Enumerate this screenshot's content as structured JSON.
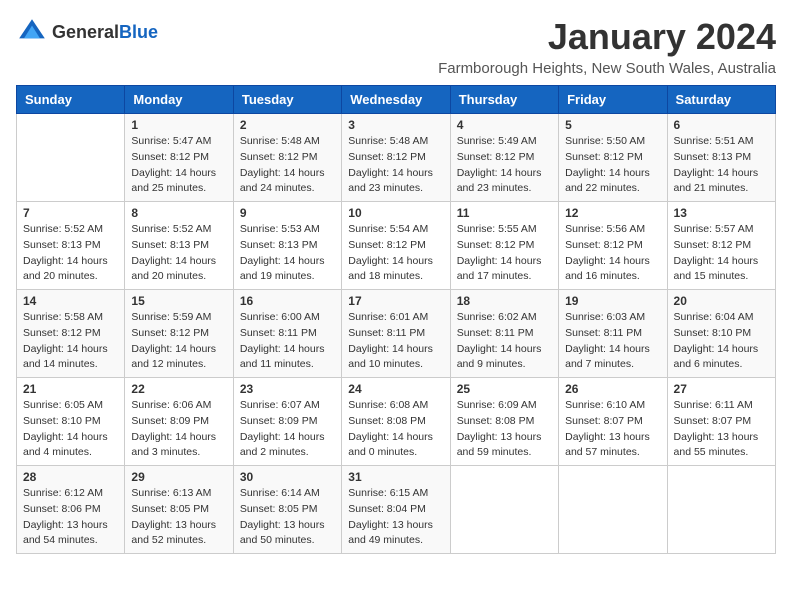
{
  "logo": {
    "general": "General",
    "blue": "Blue"
  },
  "title": "January 2024",
  "location": "Farmborough Heights, New South Wales, Australia",
  "days_of_week": [
    "Sunday",
    "Monday",
    "Tuesday",
    "Wednesday",
    "Thursday",
    "Friday",
    "Saturday"
  ],
  "weeks": [
    [
      {
        "day": "",
        "info": ""
      },
      {
        "day": "1",
        "info": "Sunrise: 5:47 AM\nSunset: 8:12 PM\nDaylight: 14 hours\nand 25 minutes."
      },
      {
        "day": "2",
        "info": "Sunrise: 5:48 AM\nSunset: 8:12 PM\nDaylight: 14 hours\nand 24 minutes."
      },
      {
        "day": "3",
        "info": "Sunrise: 5:48 AM\nSunset: 8:12 PM\nDaylight: 14 hours\nand 23 minutes."
      },
      {
        "day": "4",
        "info": "Sunrise: 5:49 AM\nSunset: 8:12 PM\nDaylight: 14 hours\nand 23 minutes."
      },
      {
        "day": "5",
        "info": "Sunrise: 5:50 AM\nSunset: 8:12 PM\nDaylight: 14 hours\nand 22 minutes."
      },
      {
        "day": "6",
        "info": "Sunrise: 5:51 AM\nSunset: 8:13 PM\nDaylight: 14 hours\nand 21 minutes."
      }
    ],
    [
      {
        "day": "7",
        "info": "Sunrise: 5:52 AM\nSunset: 8:13 PM\nDaylight: 14 hours\nand 20 minutes."
      },
      {
        "day": "8",
        "info": "Sunrise: 5:52 AM\nSunset: 8:13 PM\nDaylight: 14 hours\nand 20 minutes."
      },
      {
        "day": "9",
        "info": "Sunrise: 5:53 AM\nSunset: 8:13 PM\nDaylight: 14 hours\nand 19 minutes."
      },
      {
        "day": "10",
        "info": "Sunrise: 5:54 AM\nSunset: 8:12 PM\nDaylight: 14 hours\nand 18 minutes."
      },
      {
        "day": "11",
        "info": "Sunrise: 5:55 AM\nSunset: 8:12 PM\nDaylight: 14 hours\nand 17 minutes."
      },
      {
        "day": "12",
        "info": "Sunrise: 5:56 AM\nSunset: 8:12 PM\nDaylight: 14 hours\nand 16 minutes."
      },
      {
        "day": "13",
        "info": "Sunrise: 5:57 AM\nSunset: 8:12 PM\nDaylight: 14 hours\nand 15 minutes."
      }
    ],
    [
      {
        "day": "14",
        "info": "Sunrise: 5:58 AM\nSunset: 8:12 PM\nDaylight: 14 hours\nand 14 minutes."
      },
      {
        "day": "15",
        "info": "Sunrise: 5:59 AM\nSunset: 8:12 PM\nDaylight: 14 hours\nand 12 minutes."
      },
      {
        "day": "16",
        "info": "Sunrise: 6:00 AM\nSunset: 8:11 PM\nDaylight: 14 hours\nand 11 minutes."
      },
      {
        "day": "17",
        "info": "Sunrise: 6:01 AM\nSunset: 8:11 PM\nDaylight: 14 hours\nand 10 minutes."
      },
      {
        "day": "18",
        "info": "Sunrise: 6:02 AM\nSunset: 8:11 PM\nDaylight: 14 hours\nand 9 minutes."
      },
      {
        "day": "19",
        "info": "Sunrise: 6:03 AM\nSunset: 8:11 PM\nDaylight: 14 hours\nand 7 minutes."
      },
      {
        "day": "20",
        "info": "Sunrise: 6:04 AM\nSunset: 8:10 PM\nDaylight: 14 hours\nand 6 minutes."
      }
    ],
    [
      {
        "day": "21",
        "info": "Sunrise: 6:05 AM\nSunset: 8:10 PM\nDaylight: 14 hours\nand 4 minutes."
      },
      {
        "day": "22",
        "info": "Sunrise: 6:06 AM\nSunset: 8:09 PM\nDaylight: 14 hours\nand 3 minutes."
      },
      {
        "day": "23",
        "info": "Sunrise: 6:07 AM\nSunset: 8:09 PM\nDaylight: 14 hours\nand 2 minutes."
      },
      {
        "day": "24",
        "info": "Sunrise: 6:08 AM\nSunset: 8:08 PM\nDaylight: 14 hours\nand 0 minutes."
      },
      {
        "day": "25",
        "info": "Sunrise: 6:09 AM\nSunset: 8:08 PM\nDaylight: 13 hours\nand 59 minutes."
      },
      {
        "day": "26",
        "info": "Sunrise: 6:10 AM\nSunset: 8:07 PM\nDaylight: 13 hours\nand 57 minutes."
      },
      {
        "day": "27",
        "info": "Sunrise: 6:11 AM\nSunset: 8:07 PM\nDaylight: 13 hours\nand 55 minutes."
      }
    ],
    [
      {
        "day": "28",
        "info": "Sunrise: 6:12 AM\nSunset: 8:06 PM\nDaylight: 13 hours\nand 54 minutes."
      },
      {
        "day": "29",
        "info": "Sunrise: 6:13 AM\nSunset: 8:05 PM\nDaylight: 13 hours\nand 52 minutes."
      },
      {
        "day": "30",
        "info": "Sunrise: 6:14 AM\nSunset: 8:05 PM\nDaylight: 13 hours\nand 50 minutes."
      },
      {
        "day": "31",
        "info": "Sunrise: 6:15 AM\nSunset: 8:04 PM\nDaylight: 13 hours\nand 49 minutes."
      },
      {
        "day": "",
        "info": ""
      },
      {
        "day": "",
        "info": ""
      },
      {
        "day": "",
        "info": ""
      }
    ]
  ]
}
